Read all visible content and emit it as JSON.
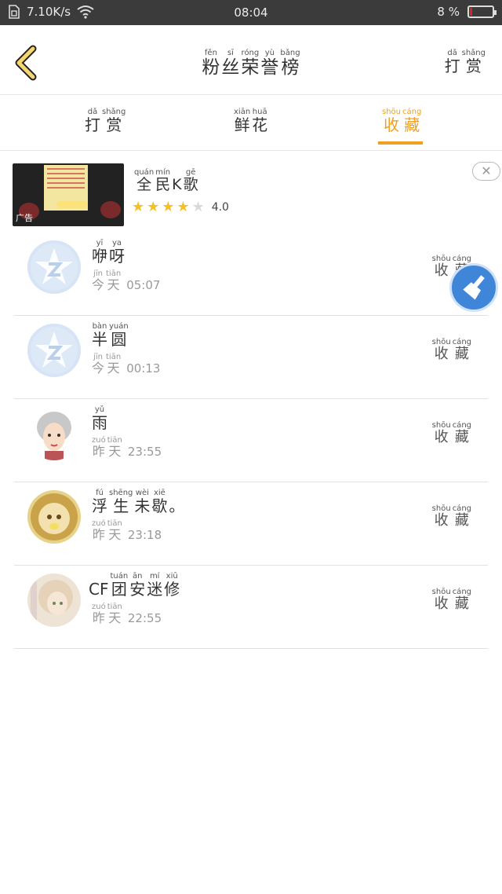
{
  "status_bar": {
    "speed": "7.10K/s",
    "time": "08:04",
    "battery": "8 %"
  },
  "header": {
    "title": [
      {
        "py": "fěn",
        "hz": "粉"
      },
      {
        "py": "sī",
        "hz": "丝"
      },
      {
        "py": "róng",
        "hz": "荣"
      },
      {
        "py": "yù",
        "hz": "誉"
      },
      {
        "py": "bǎng",
        "hz": "榜"
      }
    ],
    "right_action": [
      {
        "py": "dǎ",
        "hz": "打"
      },
      {
        "py": "shǎng",
        "hz": "赏"
      }
    ]
  },
  "tabs": [
    {
      "chars": [
        {
          "py": "dǎ",
          "hz": "打"
        },
        {
          "py": "shǎng",
          "hz": "赏"
        }
      ],
      "active": false
    },
    {
      "chars": [
        {
          "py": "xiān",
          "hz": "鲜"
        },
        {
          "py": "huā",
          "hz": "花"
        }
      ],
      "active": false
    },
    {
      "chars": [
        {
          "py": "shōu",
          "hz": "收"
        },
        {
          "py": "cáng",
          "hz": "藏"
        }
      ],
      "active": true
    }
  ],
  "ad": {
    "name": [
      {
        "py": "quán",
        "hz": "全"
      },
      {
        "py": "mín",
        "hz": "民"
      },
      {
        "py": "",
        "hz": "K"
      },
      {
        "py": "gē",
        "hz": "歌"
      }
    ],
    "rating": "4.0",
    "stars": 4,
    "thumb_caption": "广告"
  },
  "list": [
    {
      "name": [
        {
          "py": "yī",
          "hz": "咿"
        },
        {
          "py": "ya",
          "hz": "呀"
        }
      ],
      "day": [
        {
          "py": "jīn",
          "hz": "今"
        },
        {
          "py": "tiān",
          "hz": "天"
        }
      ],
      "time": "05:07",
      "action": [
        {
          "py": "shōu",
          "hz": "收"
        },
        {
          "py": "cáng",
          "hz": "藏"
        }
      ]
    },
    {
      "name": [
        {
          "py": "bàn",
          "hz": "半"
        },
        {
          "py": "yuán",
          "hz": "圆"
        }
      ],
      "day": [
        {
          "py": "jīn",
          "hz": "今"
        },
        {
          "py": "tiān",
          "hz": "天"
        }
      ],
      "time": "00:13",
      "action": [
        {
          "py": "shōu",
          "hz": "收"
        },
        {
          "py": "cáng",
          "hz": "藏"
        }
      ]
    },
    {
      "name": [
        {
          "py": "yǔ",
          "hz": "雨"
        }
      ],
      "day": [
        {
          "py": "zuó",
          "hz": "昨"
        },
        {
          "py": "tiān",
          "hz": "天"
        }
      ],
      "time": "23:55",
      "action": [
        {
          "py": "shōu",
          "hz": "收"
        },
        {
          "py": "cáng",
          "hz": "藏"
        }
      ]
    },
    {
      "name": [
        {
          "py": "fú",
          "hz": "浮"
        },
        {
          "py": "shēng",
          "hz": "生"
        },
        {
          "py": "wèi",
          "hz": "未"
        },
        {
          "py": "xiē",
          "hz": "歇"
        },
        {
          "py": "",
          "hz": "。"
        }
      ],
      "day": [
        {
          "py": "zuó",
          "hz": "昨"
        },
        {
          "py": "tiān",
          "hz": "天"
        }
      ],
      "time": "23:18",
      "action": [
        {
          "py": "shōu",
          "hz": "收"
        },
        {
          "py": "cáng",
          "hz": "藏"
        }
      ]
    },
    {
      "name": [
        {
          "py": "",
          "hz": "CF"
        },
        {
          "py": "tuán",
          "hz": "团"
        },
        {
          "py": "ān",
          "hz": "安"
        },
        {
          "py": "mí",
          "hz": "迷"
        },
        {
          "py": "xiū",
          "hz": "修"
        }
      ],
      "day": [
        {
          "py": "zuó",
          "hz": "昨"
        },
        {
          "py": "tiān",
          "hz": "天"
        }
      ],
      "time": "22:55",
      "action": [
        {
          "py": "shōu",
          "hz": "收"
        },
        {
          "py": "cáng",
          "hz": "藏"
        }
      ]
    }
  ],
  "colors": {
    "accent": "#f0a020",
    "status_bar": "#3b3b3b",
    "divider": "#e6e6e6",
    "fab": "#3f86d9"
  }
}
